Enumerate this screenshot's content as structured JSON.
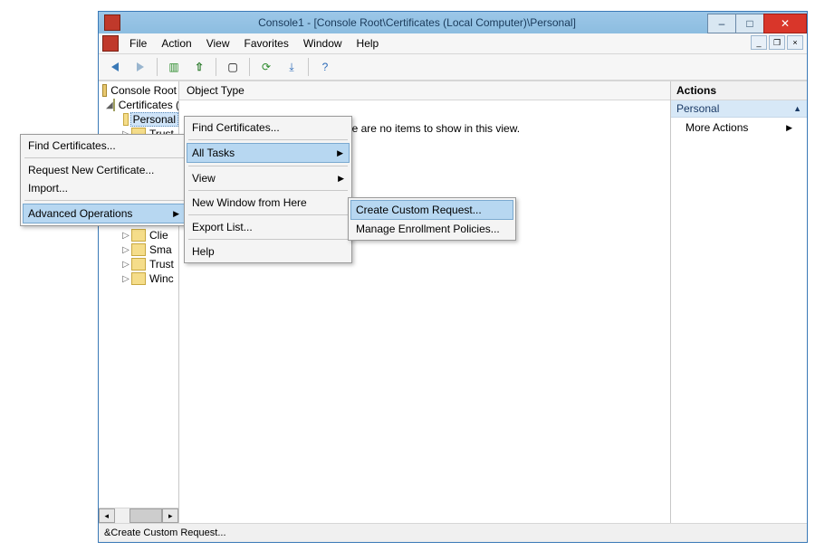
{
  "window": {
    "title": "Console1 - [Console Root\\Certificates (Local Computer)\\Personal]"
  },
  "menubar": {
    "file": "File",
    "action": "Action",
    "view": "View",
    "favorites": "Favorites",
    "window": "Window",
    "help": "Help"
  },
  "tree": {
    "root": "Console Root",
    "certs": "Certificates (Local Compute",
    "personal": "Personal",
    "n1": "Trust",
    "n3": "Clie",
    "n4": "Sma",
    "n5": "Trust",
    "n6": "Winc"
  },
  "list": {
    "header": "Object Type",
    "empty": "There are no items to show in this view."
  },
  "actions": {
    "head": "Actions",
    "section": "Personal",
    "more": "More Actions"
  },
  "status": "&Create Custom Request...",
  "ctx1": {
    "find": "Find Certificates...",
    "req": "Request New Certificate...",
    "imp": "Import...",
    "adv": "Advanced Operations"
  },
  "ctx2": {
    "find": "Find Certificates...",
    "all": "All Tasks",
    "view": "View",
    "newwin": "New Window from Here",
    "export": "Export List...",
    "help": "Help"
  },
  "ctx3": {
    "create": "Create Custom Request...",
    "manage": "Manage Enrollment Policies..."
  }
}
